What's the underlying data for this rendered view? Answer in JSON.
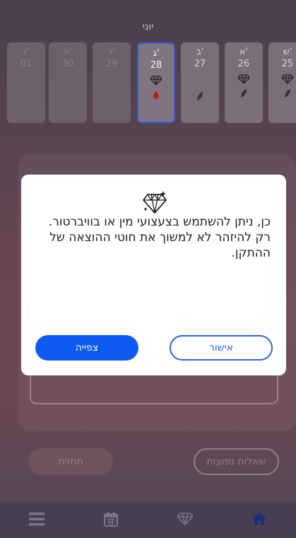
{
  "month": "יוני",
  "days": [
    {
      "name": "ו'",
      "date": "01"
    },
    {
      "name": "ה'",
      "date": "30"
    },
    {
      "name": "ד'",
      "date": "29"
    },
    {
      "name": "ג'",
      "date": "28"
    },
    {
      "name": "ב'",
      "date": "27"
    },
    {
      "name": "א'",
      "date": "26"
    },
    {
      "name": "ש'",
      "date": "25"
    }
  ],
  "bottom_buttons": {
    "left": "תחזית",
    "right": "שאלות נפוצות"
  },
  "dialog": {
    "message": "כן, ניתן להשתמש בצעצועי מין או בוויברטור. רק להיזהר לא למשוך את חוטי ההוצאה של ההתקן.",
    "view_label": "צפייה",
    "ok_label": "אישור"
  },
  "colors": {
    "primary": "#0f5bf2",
    "accent_outline": "#2d63e8",
    "drop": "#c3141d",
    "selected_border": "#3a5bd8"
  },
  "icons": {
    "dialog": "diamond-icon",
    "tabs": [
      "menu-icon",
      "calendar-icon",
      "diamond-icon",
      "home-icon"
    ]
  }
}
